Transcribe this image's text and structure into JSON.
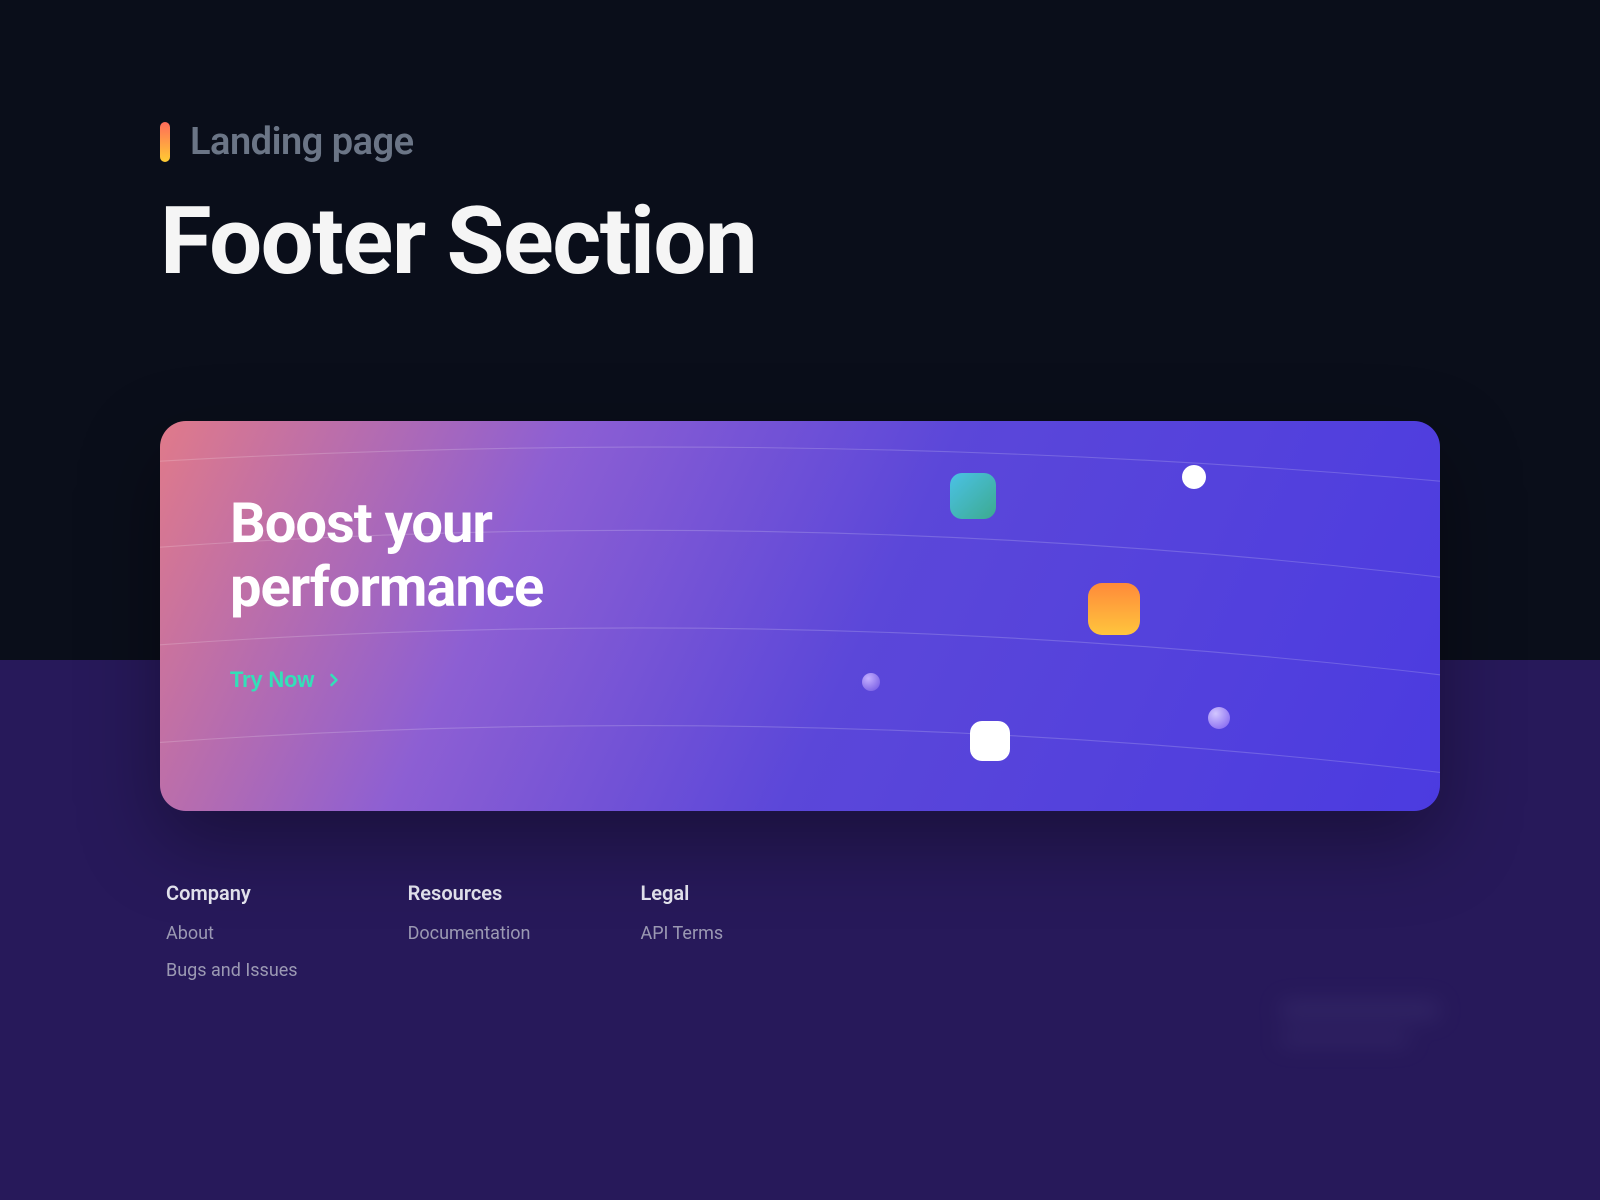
{
  "header": {
    "eyebrow": "Landing page",
    "title": "Footer Section"
  },
  "cta": {
    "headline": "Boost your performance",
    "button_label": "Try Now"
  },
  "footer": {
    "columns": [
      {
        "title": "Company",
        "links": [
          "About",
          "Bugs and Issues"
        ]
      },
      {
        "title": "Resources",
        "links": [
          "Documentation"
        ]
      },
      {
        "title": "Legal",
        "links": [
          "API Terms"
        ]
      }
    ]
  },
  "colors": {
    "accent_cta": "#33e0b8",
    "bg_dark": "#0a0e1a",
    "bg_purple": "#27195a"
  }
}
